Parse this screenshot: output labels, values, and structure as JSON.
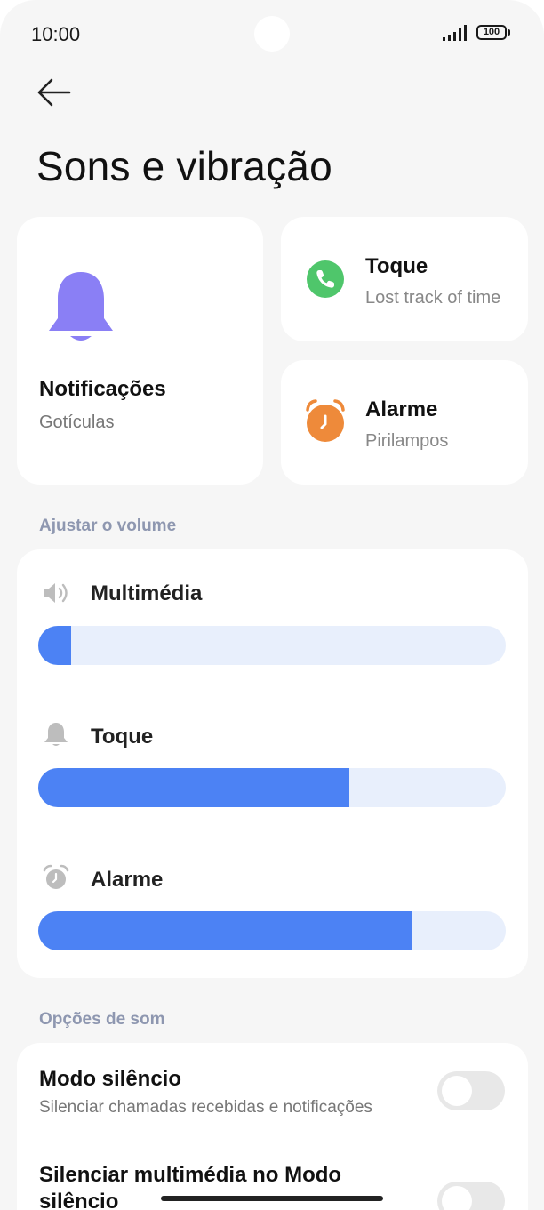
{
  "status_bar": {
    "time": "10:00",
    "battery": "100"
  },
  "header": {
    "title": "Sons e vibração"
  },
  "tiles": {
    "notifications": {
      "title": "Notificações",
      "subtitle": "Gotículas"
    },
    "ringtone": {
      "title": "Toque",
      "subtitle": "Lost track of time"
    },
    "alarm": {
      "title": "Alarme",
      "subtitle": "Pirilampos"
    }
  },
  "volume": {
    "section_label": "Ajustar o volume",
    "rows": [
      {
        "label": "Multimédia",
        "icon": "speaker-icon",
        "level": 0.07
      },
      {
        "label": "Toque",
        "icon": "bell-icon",
        "level": 0.665
      },
      {
        "label": "Alarme",
        "icon": "alarm-clock-icon",
        "level": 0.8
      }
    ]
  },
  "sound_options": {
    "section_label": "Opções de som",
    "items": [
      {
        "title": "Modo silêncio",
        "subtitle": "Silenciar chamadas recebidas e notificações",
        "enabled": false
      },
      {
        "title": "Silenciar multimédia no Modo silêncio",
        "enabled": false
      }
    ]
  },
  "colors": {
    "accent": "#4c82f4",
    "slider_track": "#e8effc",
    "bell": "#8a7ff5",
    "ringtone_icon": "#4fc66b",
    "alarm_icon": "#ee8a3a",
    "section_label": "#8e97b0"
  }
}
